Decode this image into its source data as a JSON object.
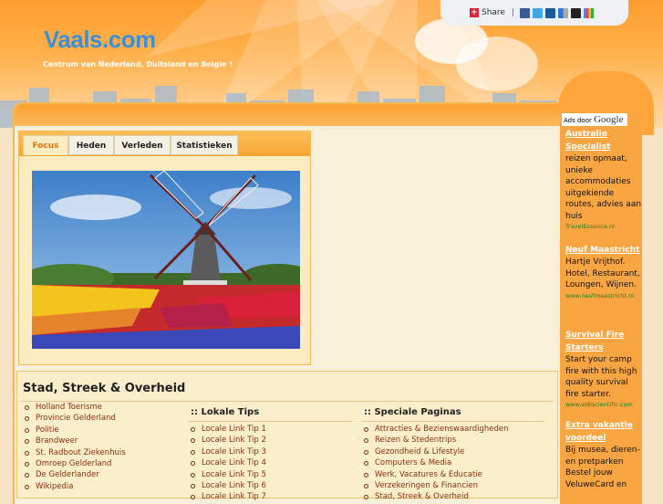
{
  "header": {
    "logo": "Vaals.com",
    "tagline": "Centrum van Nederland, Duitsland en Belgie !"
  },
  "sharebar": {
    "share_label": "Share",
    "separator": "|",
    "icons": [
      "facebook-icon",
      "twitter-icon",
      "digg-icon",
      "delicious-icon",
      "myspace-icon",
      "google-icon"
    ]
  },
  "tabs": {
    "items": [
      "Focus",
      "Heden",
      "Verleden",
      "Statistieken"
    ],
    "active": "Focus"
  },
  "photo": {
    "subject": "windmill-with-tulip-field"
  },
  "section": {
    "title": "Stad, Streek & Overheid",
    "col1": [
      "Holland Toerisme",
      "Provincie Gelderland",
      "Politie",
      "Brandweer",
      "St. Radbout Ziekenhuis",
      "Omroep Gelderland",
      "De Gelderlander",
      "Wikipedia"
    ],
    "col2_title": ":: Lokale Tips",
    "col2": [
      "Locale Link Tip 1",
      "Locale Link Tip 2",
      "Locale Link Tip 3",
      "Locale Link Tip 4",
      "Locale Link Tip 5",
      "Locale Link Tip 6",
      "Locale Link Tip 7"
    ],
    "col3_title": ":: Speciale Paginas",
    "col3": [
      "Attracties & Bezienswaardigheden",
      "Reizen & Stedentrips",
      "Gezondheid & Lifestyle",
      "Computers & Media",
      "Werk, Vacatures & Educatie",
      "Verzekeringen & Financien",
      "Stad, Streek & Overheid"
    ]
  },
  "ads": {
    "ads_by": "Ads door",
    "google": "Google",
    "items": [
      {
        "title": "Australie Specialist",
        "body": "reizen opmaat, unieke accommodaties uitgekiende routes, advies aan huis",
        "url": "TravelEssence.nl"
      },
      {
        "title": "Neuf Maastricht",
        "body": "Hartje Vrijthof. Hotel, Restaurant, Loungen, Wijnen.",
        "url": "www.neufmaastricht.nl"
      },
      {
        "title": "Survival Fire Starters",
        "body": "Start your camp fire with this high quality survival fire starter.",
        "url": "www.sobscientific.com"
      },
      {
        "title": "Extra vakantie voordeel",
        "body": "Bij musea, dieren- en pretparken Bestel jouw VeluweCard en",
        "url": ""
      }
    ]
  },
  "colors": {
    "logo": "#3b8fd8",
    "accent": "#f7a532",
    "active_tab": "#e6760a",
    "link": "#8a2f10",
    "ad_url": "#2b7a1e"
  }
}
